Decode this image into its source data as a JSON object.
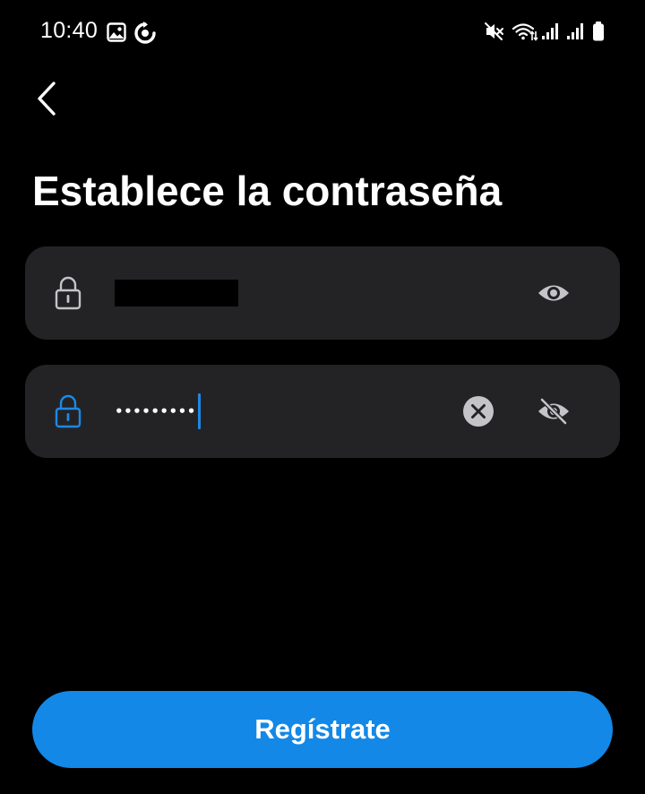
{
  "status_bar": {
    "time": "10:40",
    "left_icons": [
      "gallery-icon",
      "sync-icon"
    ],
    "right_icons": [
      "mute-icon",
      "wifi-icon",
      "signal-icon",
      "signal-icon",
      "battery-icon"
    ]
  },
  "header": {
    "back_icon": "chevron-left-icon",
    "title": "Establece la contraseña"
  },
  "fields": [
    {
      "icon": "lock-icon",
      "value_redacted": true,
      "visibility_icon": "eye-icon"
    },
    {
      "icon": "lock-icon",
      "value": "•••••••••",
      "focused": true,
      "clear_icon": "clear-icon",
      "visibility_icon": "eye-off-icon"
    }
  ],
  "actions": {
    "register_label": "Regístrate"
  },
  "colors": {
    "background": "#000000",
    "field_background": "#232326",
    "accent": "#1388e6",
    "focused_icon": "#1e88e5",
    "icon_gray": "#c4c4c8"
  }
}
